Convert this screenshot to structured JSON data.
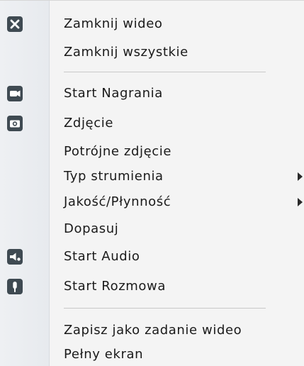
{
  "menu": {
    "items": [
      {
        "label": "Zamknij wideo",
        "icon": "close-icon"
      },
      {
        "label": "Zamknij wszystkie"
      },
      {
        "label": "Start Nagrania",
        "icon": "video-camera-icon"
      },
      {
        "label": "Zdjęcie",
        "icon": "camera-icon"
      },
      {
        "label": "Potrójne zdjęcie"
      },
      {
        "label": "Typ strumienia",
        "submenu": true
      },
      {
        "label": "Jakość/Płynność",
        "submenu": true
      },
      {
        "label": "Dopasuj"
      },
      {
        "label": "Start Audio",
        "icon": "speaker-icon"
      },
      {
        "label": "Start Rozmowa",
        "icon": "microphone-icon"
      },
      {
        "label": "Zapisz jako zadanie wideo"
      },
      {
        "label": "Pełny ekran"
      }
    ]
  }
}
